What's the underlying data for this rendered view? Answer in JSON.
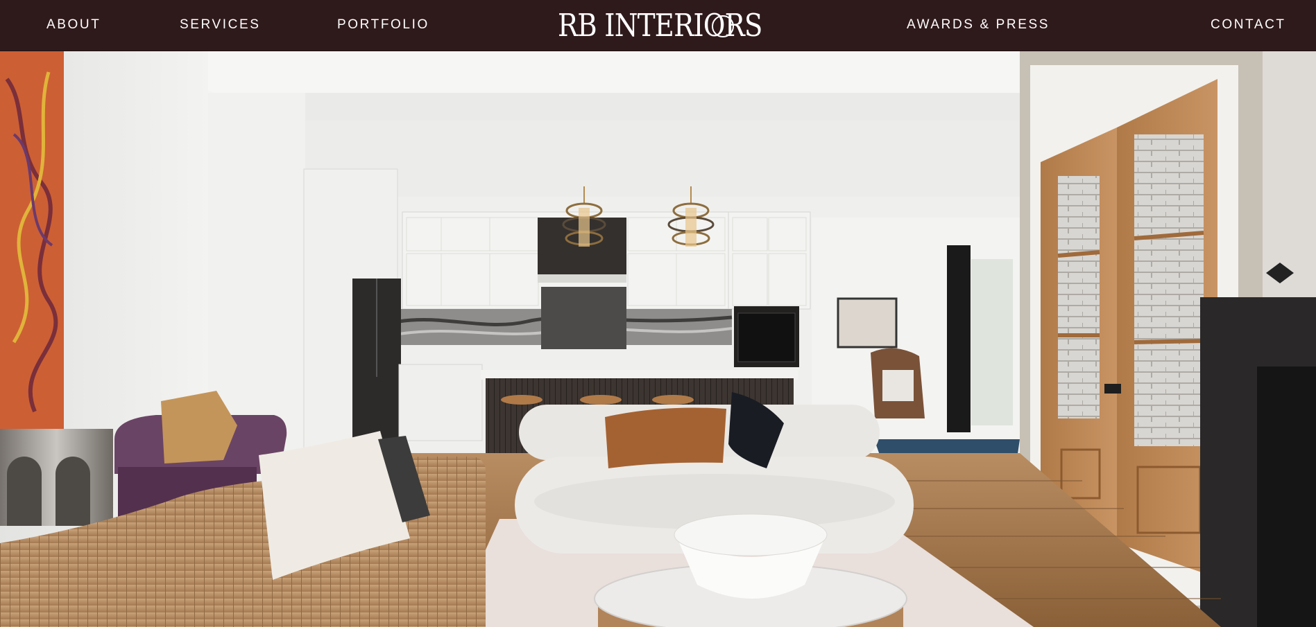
{
  "nav": {
    "about": "ABOUT",
    "services": "SERVICES",
    "portfolio": "PORTFOLIO",
    "awards_press": "AWARDS & PRESS",
    "contact": "CONTACT"
  },
  "logo": {
    "wordmark": "RB INTERIORS",
    "seal_top": "EST",
    "seal_year": "2009"
  },
  "colors": {
    "nav_background": "#2f1a1b",
    "nav_text": "#ffffff"
  },
  "hero": {
    "image": "interior-living-room-kitchen-photo"
  }
}
